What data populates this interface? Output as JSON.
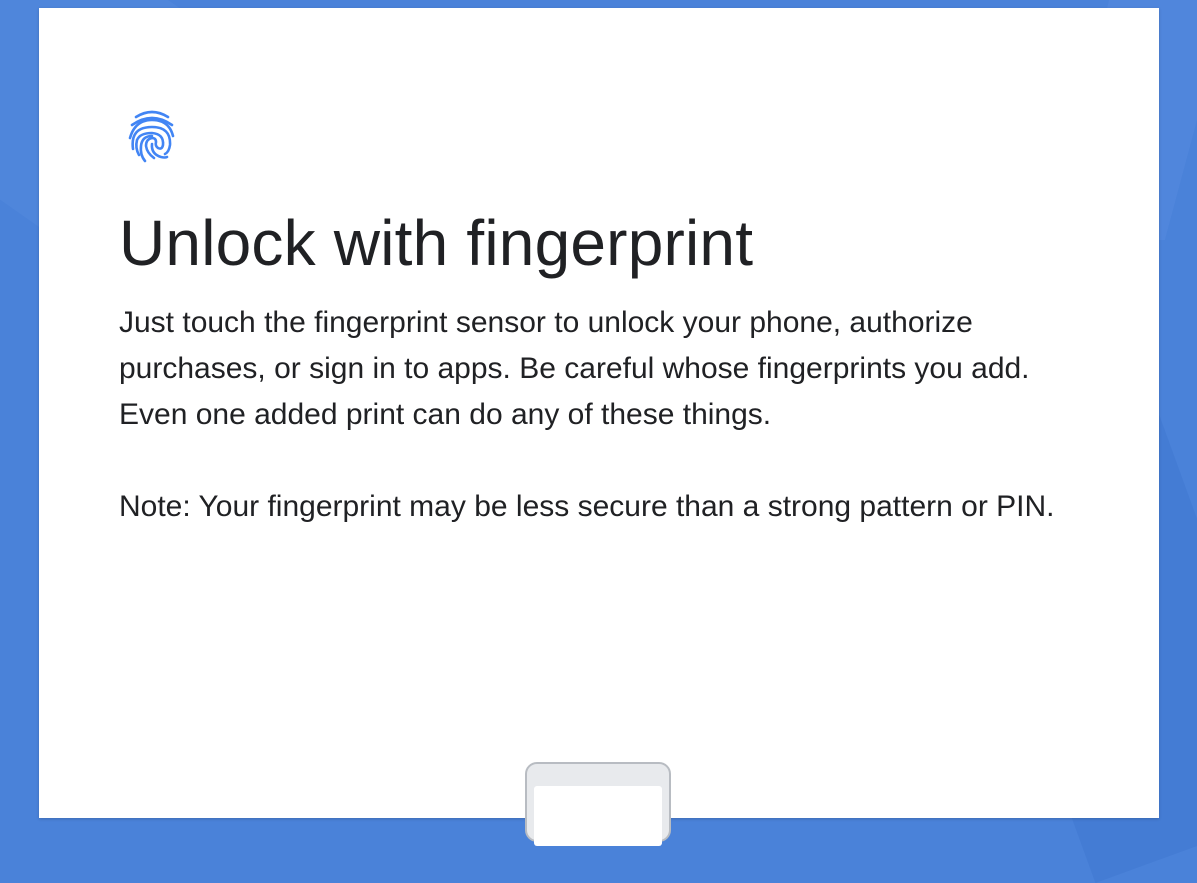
{
  "screen": {
    "title": "Unlock with fingerprint",
    "description": "Just touch the fingerprint sensor to unlock your phone, authorize purchases, or sign in to apps. Be careful whose fingerprints you add. Even one added print can do any of these things.",
    "note": "Note: Your fingerprint may be less secure than a strong pattern or PIN."
  },
  "icons": {
    "header_icon": "fingerprint-icon",
    "illustration": "phone-illustration"
  },
  "colors": {
    "background": "#4a82d9",
    "card": "#ffffff",
    "accent": "#4285f4",
    "text": "#202124"
  }
}
